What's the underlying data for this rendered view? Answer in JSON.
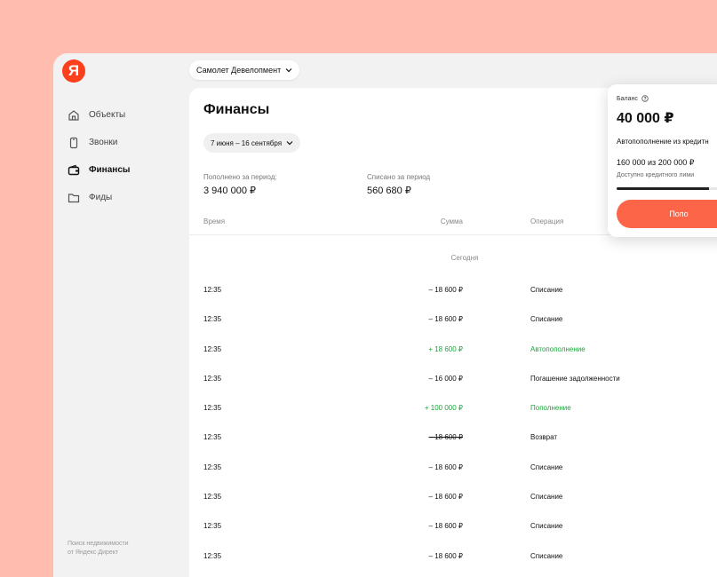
{
  "org_selector": {
    "label": "Самолет Девелопмент"
  },
  "sidebar": {
    "logo": "Я",
    "items": [
      {
        "label": "Объекты",
        "icon": "home-icon"
      },
      {
        "label": "Звонки",
        "icon": "phone-icon"
      },
      {
        "label": "Финансы",
        "icon": "wallet-icon",
        "active": true
      },
      {
        "label": "Фиды",
        "icon": "folder-icon"
      }
    ],
    "footer_line1": "Поиск недвижимости",
    "footer_line2": "от Яндекс Директ"
  },
  "main": {
    "title": "Финансы",
    "date_range": "7 июня – 16 сентября",
    "stats": {
      "topped_up_label": "Пополнено за период:",
      "topped_up_value": "3 940 000 ₽",
      "spent_label": "Списано за период",
      "spent_value": "560 680 ₽"
    },
    "table": {
      "headers": {
        "time": "Время",
        "sum": "Сумма",
        "operation": "Операция"
      },
      "group_label": "Сегодня",
      "rows": [
        {
          "time": "12:35",
          "sum": "– 18 600 ₽",
          "operation": "Списание",
          "type": "neg"
        },
        {
          "time": "12:35",
          "sum": "– 18 600 ₽",
          "operation": "Списание",
          "type": "neg"
        },
        {
          "time": "12:35",
          "sum": "+ 18 600 ₽",
          "operation": "Автопополнение",
          "type": "pos"
        },
        {
          "time": "12:35",
          "sum": "– 16 000 ₽",
          "operation": "Погашение задолженности",
          "type": "neg"
        },
        {
          "time": "12:35",
          "sum": "+ 100 000 ₽",
          "operation": "Пополнение",
          "type": "pos"
        },
        {
          "time": "12:35",
          "sum": "– 18 600 ₽",
          "operation": "Возврат",
          "type": "strike"
        },
        {
          "time": "12:35",
          "sum": "– 18 600 ₽",
          "operation": "Списание",
          "type": "neg"
        },
        {
          "time": "12:35",
          "sum": "– 18 600 ₽",
          "operation": "Списание",
          "type": "neg"
        },
        {
          "time": "12:35",
          "sum": "– 18 600 ₽",
          "operation": "Списание",
          "type": "neg"
        },
        {
          "time": "12:35",
          "sum": "– 18 600 ₽",
          "operation": "Списание",
          "type": "neg"
        }
      ]
    }
  },
  "balance_card": {
    "label": "Баланс",
    "amount": "40 000 ₽",
    "autotopup": "Автопополнение из кредитн",
    "limit": "160 000 из 200 000 ₽",
    "available": "Доступно кредитного лими",
    "limit_fraction": 0.8,
    "button": "Попо"
  },
  "colors": {
    "accent": "#fd6548",
    "positive": "#1ca43c",
    "background": "#ffbcaf"
  }
}
